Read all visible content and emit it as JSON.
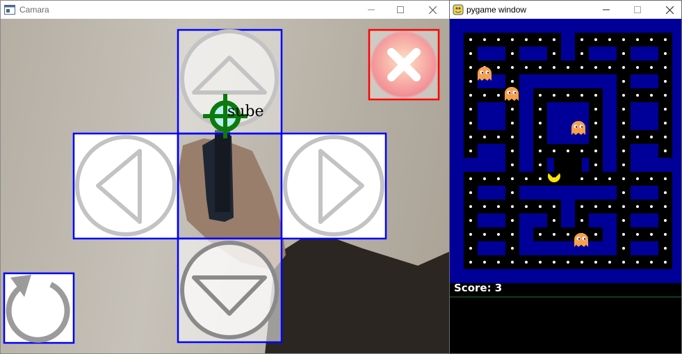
{
  "camera_window": {
    "title": "Camara",
    "overlay_label": "sube",
    "icons": {
      "app": "camera-app-icon",
      "up": "up-arrow-icon",
      "left": "left-arrow-icon",
      "right": "right-arrow-icon",
      "down": "down-arrow-icon",
      "close": "close-x-icon",
      "reset": "reset-rotate-icon",
      "pointer": "crosshair-pointer-icon"
    },
    "colors": {
      "button_border": "#0000ff",
      "close_border": "#ff0000",
      "pointer": "#0c7a0c",
      "close_fill": "#f6a0a2"
    }
  },
  "game_window": {
    "title": "pygame window",
    "score_label": "Score: 3",
    "icons": {
      "app": "pygame-snake-icon",
      "player": "pacman-icon",
      "enemy": "ghost-icon"
    },
    "colors": {
      "maze_wall": "#000099",
      "pellet": "#ffffff",
      "pacman": "#ffe400",
      "ghost": "#f7a14a"
    }
  },
  "window_controls": {
    "minimize": "minimize-icon",
    "maximize": "maximize-icon",
    "close": "window-close-icon"
  }
}
